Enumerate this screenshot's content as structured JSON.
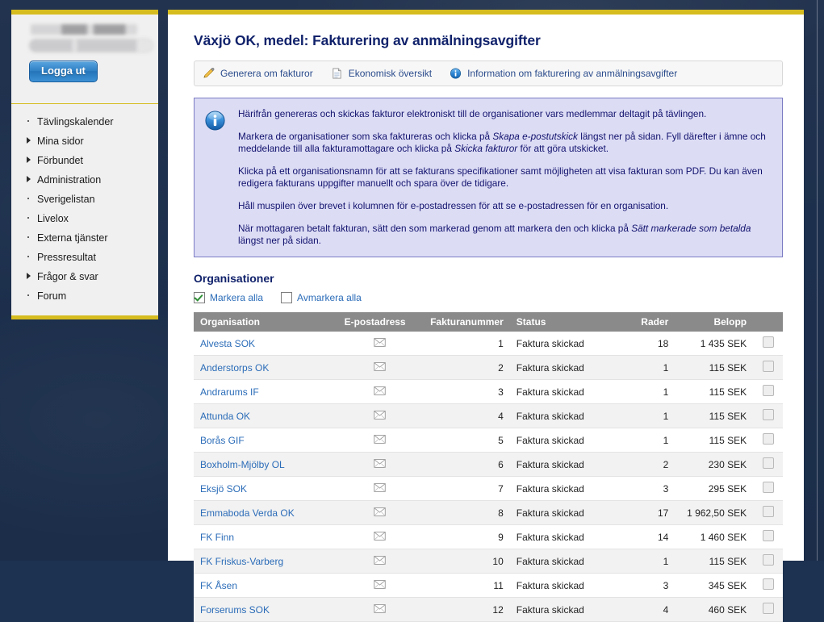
{
  "sidebar": {
    "greeting_redacted": "",
    "greeting_sub_redacted": "",
    "logout_label": "Logga ut",
    "items": [
      {
        "label": "Tävlingskalender",
        "marker": "dot"
      },
      {
        "label": "Mina sidor",
        "marker": "arrow"
      },
      {
        "label": "Förbundet",
        "marker": "arrow"
      },
      {
        "label": "Administration",
        "marker": "arrow"
      },
      {
        "label": "Sverigelistan",
        "marker": "dot"
      },
      {
        "label": "Livelox",
        "marker": "dot"
      },
      {
        "label": "Externa tjänster",
        "marker": "dot"
      },
      {
        "label": "Pressresultat",
        "marker": "dot"
      },
      {
        "label": "Frågor & svar",
        "marker": "arrow"
      },
      {
        "label": "Forum",
        "marker": "dot"
      }
    ]
  },
  "main": {
    "title": "Växjö OK, medel: Fakturering av anmälningsavgifter",
    "toolbar": [
      {
        "label": "Generera om fakturor",
        "icon": "pencil-icon"
      },
      {
        "label": "Ekonomisk översikt",
        "icon": "document-icon"
      },
      {
        "label": "Information om fakturering av anmälningsavgifter",
        "icon": "info-icon"
      }
    ],
    "infobox": {
      "icon": "info-icon",
      "paragraphs": [
        {
          "parts": [
            {
              "text": "Härifrån genereras och skickas fakturor elektroniskt till de organisationer vars medlemmar deltagit på tävlingen.",
              "italic": false
            }
          ]
        },
        {
          "parts": [
            {
              "text": "Markera de organisationer som ska faktureras och klicka på ",
              "italic": false
            },
            {
              "text": "Skapa e-postutskick",
              "italic": true
            },
            {
              "text": " längst ner på sidan. Fyll därefter i ämne och meddelande till alla fakturamottagare och klicka på ",
              "italic": false
            },
            {
              "text": "Skicka fakturor",
              "italic": true
            },
            {
              "text": " för att göra utskicket.",
              "italic": false
            }
          ]
        },
        {
          "parts": [
            {
              "text": "Klicka på ett organisationsnamn för att se fakturans specifikationer samt möjligheten att visa fakturan som PDF. Du kan även redigera fakturans uppgifter manuellt och spara över de tidigare.",
              "italic": false
            }
          ]
        },
        {
          "parts": [
            {
              "text": "Håll muspilen över brevet i kolumnen för e-postadressen för att se e-postadressen för en organisation.",
              "italic": false
            }
          ]
        },
        {
          "parts": [
            {
              "text": "När mottagaren betalt fakturan, sätt den som markerad genom att markera den och klicka på ",
              "italic": false
            },
            {
              "text": "Sätt markerade som betalda",
              "italic": true
            },
            {
              "text": " längst ner på sidan.",
              "italic": false
            }
          ]
        }
      ]
    },
    "section_title": "Organisationer",
    "select_all_label": "Markera alla",
    "deselect_all_label": "Avmarkera alla",
    "select_all_checked": true,
    "deselect_all_checked": false,
    "table": {
      "columns": [
        "Organisation",
        "E-postadress",
        "Fakturanummer",
        "Status",
        "Rader",
        "Belopp",
        ""
      ],
      "rows": [
        {
          "org": "Alvesta SOK",
          "email_icon": "envelope-icon",
          "invoice": "1",
          "status": "Faktura skickad",
          "rows": "18",
          "amount": "1 435 SEK",
          "checked": false
        },
        {
          "org": "Anderstorps OK",
          "email_icon": "envelope-icon",
          "invoice": "2",
          "status": "Faktura skickad",
          "rows": "1",
          "amount": "115 SEK",
          "checked": false
        },
        {
          "org": "Andrarums IF",
          "email_icon": "envelope-icon",
          "invoice": "3",
          "status": "Faktura skickad",
          "rows": "1",
          "amount": "115 SEK",
          "checked": false
        },
        {
          "org": "Attunda OK",
          "email_icon": "envelope-icon",
          "invoice": "4",
          "status": "Faktura skickad",
          "rows": "1",
          "amount": "115 SEK",
          "checked": false
        },
        {
          "org": "Borås GIF",
          "email_icon": "envelope-icon",
          "invoice": "5",
          "status": "Faktura skickad",
          "rows": "1",
          "amount": "115 SEK",
          "checked": false
        },
        {
          "org": "Boxholm-Mjölby OL",
          "email_icon": "envelope-icon",
          "invoice": "6",
          "status": "Faktura skickad",
          "rows": "2",
          "amount": "230 SEK",
          "checked": false
        },
        {
          "org": "Eksjö SOK",
          "email_icon": "envelope-icon",
          "invoice": "7",
          "status": "Faktura skickad",
          "rows": "3",
          "amount": "295 SEK",
          "checked": false
        },
        {
          "org": "Emmaboda Verda OK",
          "email_icon": "envelope-icon",
          "invoice": "8",
          "status": "Faktura skickad",
          "rows": "17",
          "amount": "1 962,50 SEK",
          "checked": false
        },
        {
          "org": "FK Finn",
          "email_icon": "envelope-icon",
          "invoice": "9",
          "status": "Faktura skickad",
          "rows": "14",
          "amount": "1 460 SEK",
          "checked": false
        },
        {
          "org": "FK Friskus-Varberg",
          "email_icon": "envelope-icon",
          "invoice": "10",
          "status": "Faktura skickad",
          "rows": "1",
          "amount": "115 SEK",
          "checked": false
        },
        {
          "org": "FK Åsen",
          "email_icon": "envelope-icon",
          "invoice": "11",
          "status": "Faktura skickad",
          "rows": "3",
          "amount": "345 SEK",
          "checked": false
        },
        {
          "org": "Forserums SOK",
          "email_icon": "envelope-icon",
          "invoice": "12",
          "status": "Faktura skickad",
          "rows": "4",
          "amount": "460 SEK",
          "checked": false
        }
      ]
    }
  },
  "colors": {
    "backdrop": "#1d3150",
    "accent_yellow": "#d6bc1f",
    "heading_blue": "#11226b",
    "link_blue": "#2b6cb8",
    "info_bg": "#dcdcf5",
    "info_border": "#7b7bc4",
    "table_header_bg": "#8a8a8a",
    "button_blue": "#2f7fc4"
  }
}
